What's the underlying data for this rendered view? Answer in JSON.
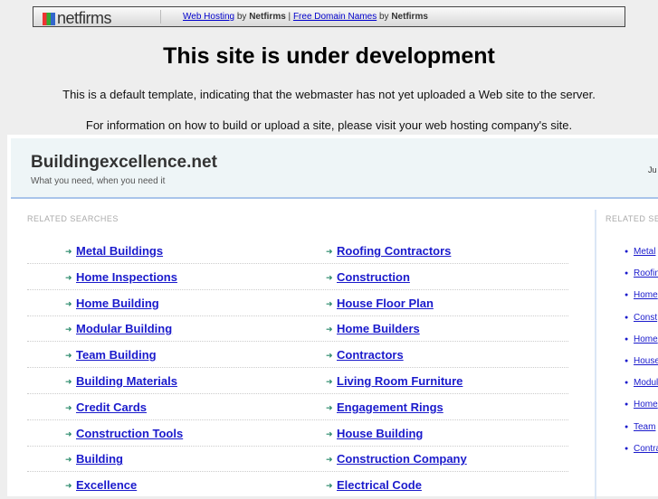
{
  "netfirms_bar": {
    "logo": "netfirms",
    "link1": "Web Hosting",
    "by1": " by ",
    "brand1": "Netfirms",
    "pipe": " | ",
    "link2": "Free Domain Names",
    "by2": " by ",
    "brand2": "Netfirms"
  },
  "title": "This site is under development",
  "info1": "This is a default template, indicating that the webmaster has not yet uploaded a Web site to the server.",
  "info2": "For information on how to build or upload a site, please visit your web hosting company's site.",
  "site": {
    "name": "Buildingexcellence.net",
    "tagline": "What you need, when you need it",
    "right_text": "Ju"
  },
  "related_label": "RELATED SEARCHES",
  "right_related_label": "RELATED SEA",
  "col1": [
    "Metal Buildings",
    "Home Inspections",
    "Home Building",
    "Modular Building",
    "Team Building",
    "Building Materials",
    "Credit Cards",
    "Construction Tools",
    "Building",
    "Excellence"
  ],
  "col2": [
    "Roofing Contractors",
    "Construction",
    "House Floor Plan",
    "Home Builders",
    "Contractors",
    "Living Room Furniture",
    "Engagement Rings",
    "House Building",
    "Construction Company",
    "Electrical Code"
  ],
  "right_links": [
    "Metal",
    "Roofin",
    "Home",
    "Const",
    "Home",
    "House",
    "Modul",
    "Home",
    "Team",
    "Contra"
  ]
}
